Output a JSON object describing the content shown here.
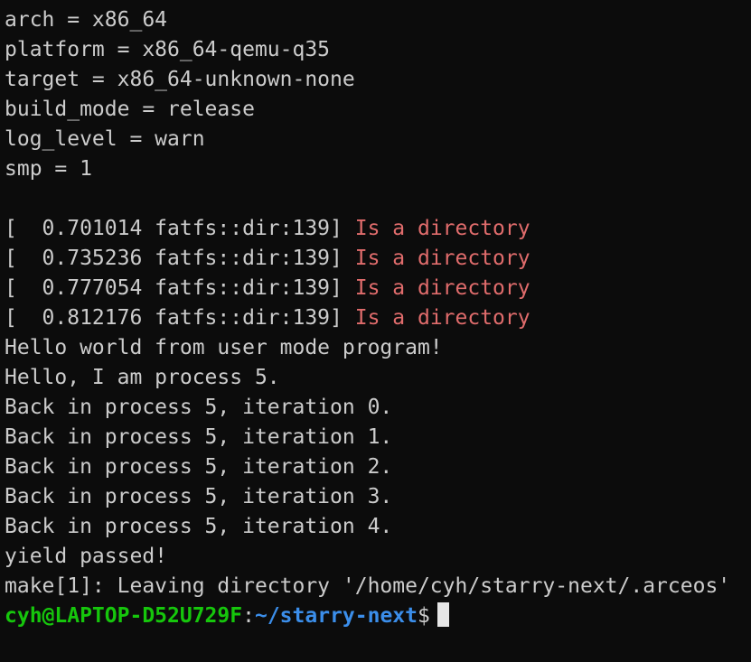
{
  "colors": {
    "background": "#0c0c0c",
    "text": "#cccccc",
    "error": "#e06c6c",
    "prompt_user": "#16c60c",
    "prompt_path": "#3b8eea"
  },
  "config_lines": [
    "arch = x86_64",
    "platform = x86_64-qemu-q35",
    "target = x86_64-unknown-none",
    "build_mode = release",
    "log_level = warn",
    "smp = 1"
  ],
  "log_lines": [
    {
      "prefix": "[  0.701014 fatfs::dir:139] ",
      "message": "Is a directory"
    },
    {
      "prefix": "[  0.735236 fatfs::dir:139] ",
      "message": "Is a directory"
    },
    {
      "prefix": "[  0.777054 fatfs::dir:139] ",
      "message": "Is a directory"
    },
    {
      "prefix": "[  0.812176 fatfs::dir:139] ",
      "message": "Is a directory"
    }
  ],
  "output_lines": [
    "Hello world from user mode program!",
    "Hello, I am process 5.",
    "Back in process 5, iteration 0.",
    "Back in process 5, iteration 1.",
    "Back in process 5, iteration 2.",
    "Back in process 5, iteration 3.",
    "Back in process 5, iteration 4.",
    "yield passed!",
    "make[1]: Leaving directory '/home/cyh/starry-next/.arceos'"
  ],
  "prompt": {
    "user_host": "cyh@LAPTOP-D52U729F",
    "separator": ":",
    "path": "~/starry-next",
    "symbol": "$"
  }
}
